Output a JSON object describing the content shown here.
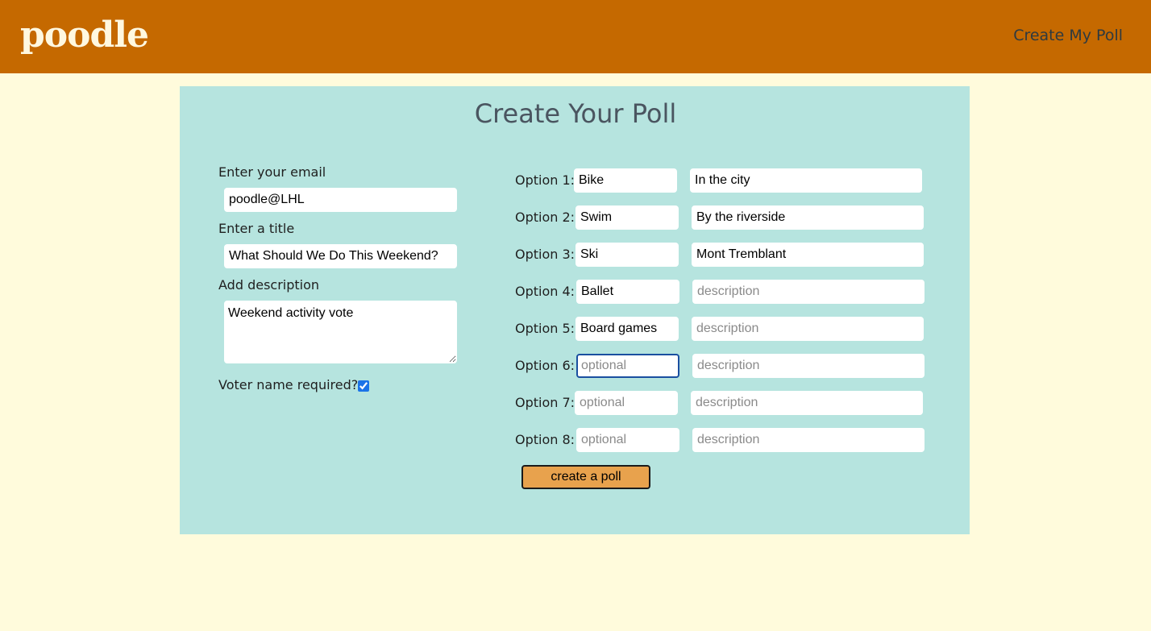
{
  "header": {
    "logo": "poodle",
    "nav_link": "Create My Poll"
  },
  "page": {
    "title": "Create Your Poll"
  },
  "form": {
    "email_label": "Enter your email",
    "email_value": "poodle@LHL",
    "title_label": "Enter a title",
    "title_value": "What Should We Do This Weekend?",
    "description_label": "Add description",
    "description_value": "Weekend activity vote",
    "voter_name_label": "Voter name required?",
    "voter_name_required": true
  },
  "options": [
    {
      "label": "Option 1:",
      "value": "Bike",
      "placeholder": "optional",
      "description": "In the city",
      "description_placeholder": "description"
    },
    {
      "label": "Option 2:",
      "value": "Swim",
      "placeholder": "optional",
      "description": "By the riverside",
      "description_placeholder": "description"
    },
    {
      "label": "Option 3:",
      "value": "Ski",
      "placeholder": "optional",
      "description": "Mont Tremblant",
      "description_placeholder": "description"
    },
    {
      "label": "Option 4:",
      "value": "Ballet",
      "placeholder": "optional",
      "description": "",
      "description_placeholder": "description"
    },
    {
      "label": "Option 5:",
      "value": "Board games",
      "placeholder": "optional",
      "description": "",
      "description_placeholder": "description"
    },
    {
      "label": "Option 6:",
      "value": "",
      "placeholder": "optional",
      "description": "",
      "description_placeholder": "description"
    },
    {
      "label": "Option 7:",
      "value": "",
      "placeholder": "optional",
      "description": "",
      "description_placeholder": "description"
    },
    {
      "label": "Option 8:",
      "value": "",
      "placeholder": "optional",
      "description": "",
      "description_placeholder": "description"
    }
  ],
  "submit_label": "create a poll",
  "colors": {
    "header": "#c56900",
    "background": "#fffbdc",
    "panel": "#b6e4df",
    "button": "#e8a24d"
  }
}
